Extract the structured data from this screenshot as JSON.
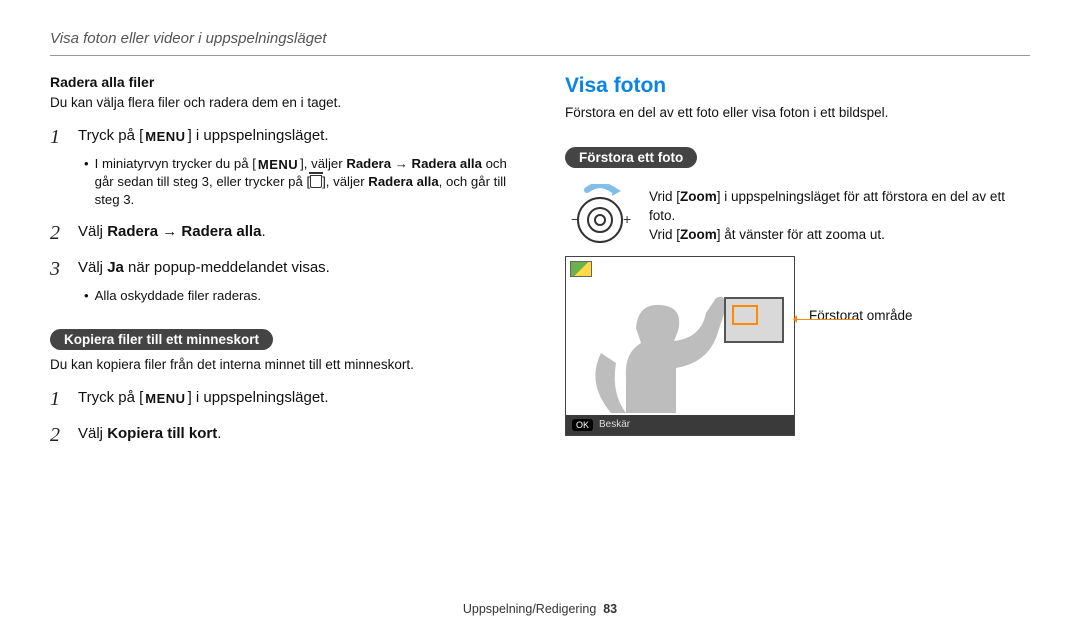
{
  "header": "Visa foton eller videor i uppspelningsläget",
  "left": {
    "radera_title": "Radera alla filer",
    "radera_desc": "Du kan välja flera filer och radera dem en i taget.",
    "step1_pre": "Tryck på [",
    "menu_label": "MENU",
    "step1_post": "] i uppspelningsläget.",
    "step1_sub_a_pre": "I miniatyrvyn trycker du på [",
    "step1_sub_a_mid": "], väljer ",
    "step1_sub_a_bold1": "Radera",
    "step1_sub_a_arrow": " → ",
    "step1_sub_a_bold2": "Radera alla",
    "step1_sub_a_post": " och går sedan till steg 3, eller trycker på [",
    "step1_sub_a_trash_post": "], väljer ",
    "step1_sub_a_bold3": "Radera alla",
    "step1_sub_a_end": ", och går till steg 3.",
    "step2_pre": "Välj ",
    "step2_b1": "Radera",
    "step2_arrow": " → ",
    "step2_b2": "Radera alla",
    "step2_post": ".",
    "step3_pre": "Välj ",
    "step3_b": "Ja",
    "step3_post": " när popup-meddelandet visas.",
    "step3_sub": "Alla oskyddade filer raderas.",
    "pill_kopiera": "Kopiera filer till ett minneskort",
    "kopiera_desc": "Du kan kopiera filer från det interna minnet till ett minneskort.",
    "k_step1_pre": "Tryck på [",
    "k_step1_post": "] i uppspelningsläget.",
    "k_step2_pre": "Välj ",
    "k_step2_b": "Kopiera till kort",
    "k_step2_post": "."
  },
  "right": {
    "section_title": "Visa foton",
    "desc": "Förstora en del av ett foto eller visa foton i ett bildspel.",
    "pill_forstora": "Förstora ett foto",
    "zoom_l1_pre": "Vrid [",
    "zoom_l1_b": "Zoom",
    "zoom_l1_post": "] i uppspelningsläget för att förstora en del av ett foto.",
    "zoom_l2_pre": "Vrid [",
    "zoom_l2_b": "Zoom",
    "zoom_l2_post": "] åt vänster för att zooma ut.",
    "callout": "Förstorat område",
    "footer_ok": "OK",
    "footer_label": "Beskär"
  },
  "footer": {
    "section": "Uppspelning/Redigering",
    "page": "83"
  }
}
